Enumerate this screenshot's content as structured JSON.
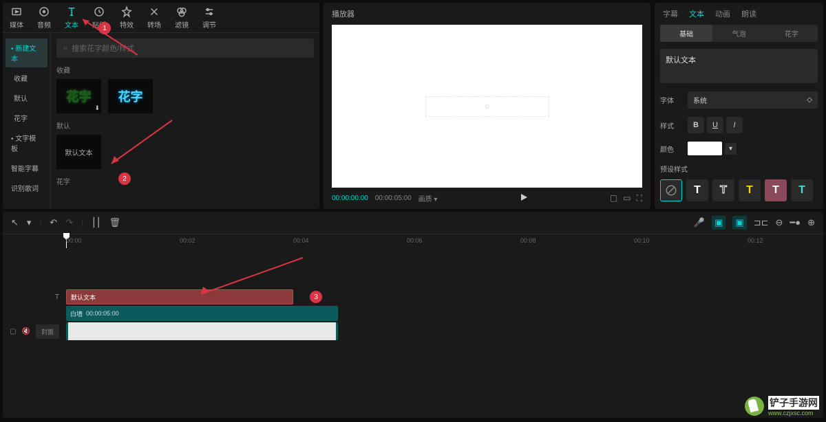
{
  "toolbar": {
    "items": [
      {
        "label": "媒体",
        "icon": "media"
      },
      {
        "label": "音频",
        "icon": "audio"
      },
      {
        "label": "文本",
        "icon": "text",
        "active": true
      },
      {
        "label": "贴纸",
        "icon": "sticker"
      },
      {
        "label": "特效",
        "icon": "effect"
      },
      {
        "label": "转场",
        "icon": "transition"
      },
      {
        "label": "滤镜",
        "icon": "filter"
      },
      {
        "label": "调节",
        "icon": "adjust"
      }
    ]
  },
  "sidebar": {
    "items": [
      {
        "label": "新建文本",
        "active": true,
        "bullet": true
      },
      {
        "label": "收藏",
        "sub": true
      },
      {
        "label": "默认",
        "sub": true
      },
      {
        "label": "花字",
        "sub": true
      },
      {
        "label": "文字模板",
        "bullet": true
      },
      {
        "label": "智能字幕"
      },
      {
        "label": "识别歌词"
      }
    ]
  },
  "search": {
    "placeholder": "搜索花字颜色/样式"
  },
  "sections": {
    "favorites": "收藏",
    "default": "默认",
    "huazi": "花字"
  },
  "thumbs": {
    "huazi1": "花字",
    "huazi2": "花字",
    "default_text": "默认文本"
  },
  "player": {
    "title": "播放器",
    "time_current": "00:00:00:00",
    "time_total": "00:00:05:00",
    "ratio": "画质"
  },
  "props": {
    "tabs": [
      "字幕",
      "文本",
      "动画",
      "朗读"
    ],
    "active_tab": 1,
    "sub_tabs": [
      "基础",
      "气泡",
      "花字"
    ],
    "active_sub": 0,
    "text_value": "默认文本",
    "font_label": "字体",
    "font_value": "系统",
    "style_label": "样式",
    "color_label": "颜色",
    "preset_label": "预设样式"
  },
  "timeline": {
    "ticks": [
      "00:00",
      "00:02",
      "00:04",
      "00:06",
      "00:08",
      "00:10",
      "00:12"
    ],
    "text_clip": "默认文本",
    "audio_clip_name": "白墙",
    "audio_clip_time": "00:00:05:00",
    "cover": "封面"
  },
  "annotations": {
    "n1": "1",
    "n2": "2",
    "n3": "3"
  },
  "watermark": {
    "title": "铲子手游网",
    "url": "www.czjxsc.com"
  }
}
